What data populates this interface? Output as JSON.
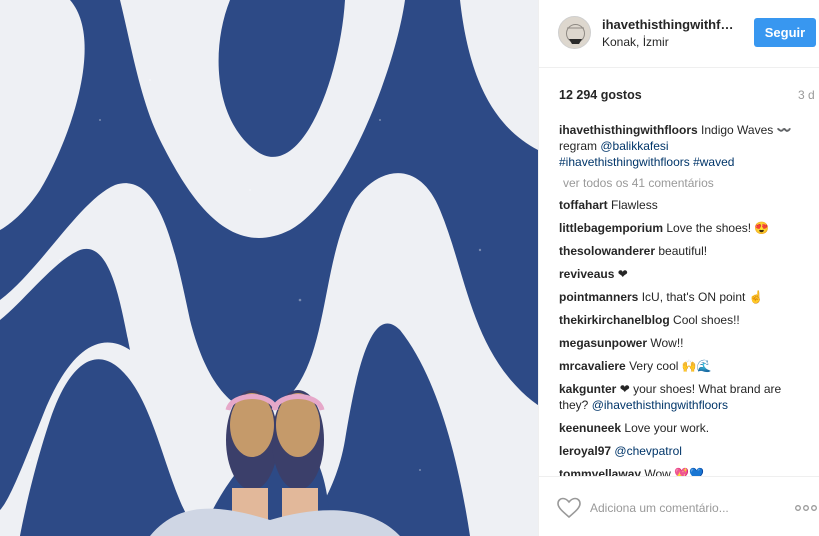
{
  "post": {
    "username": "ihavethisthingwithfloors",
    "location": "Konak, İzmir",
    "follow_label": "Seguir",
    "likes": "12 294 gostos",
    "time": "3 d"
  },
  "caption": {
    "user": "ihavethisthingwithfloors",
    "text": "Indigo Waves 〰️ regram ",
    "mention": "@balikkafesi",
    "tags": "#ihavethisthingwithfloors #waved"
  },
  "load_more": "ver todos os 41 comentários",
  "comments": [
    {
      "user": "toffahart",
      "text": "Flawless",
      "mention": ""
    },
    {
      "user": "littlebagemporium",
      "text": "Love the shoes! 😍",
      "mention": ""
    },
    {
      "user": "thesolowanderer",
      "text": "beautiful!",
      "mention": ""
    },
    {
      "user": "reviveaus",
      "text": "❤",
      "mention": ""
    },
    {
      "user": "pointmanners",
      "text": "IcU, that's ON point ☝",
      "mention": ""
    },
    {
      "user": "thekirkirchanelblog",
      "text": "Cool shoes!!",
      "mention": ""
    },
    {
      "user": "megasunpower",
      "text": "Wow!!",
      "mention": ""
    },
    {
      "user": "mrcavaliere",
      "text": "Very cool 🙌🌊",
      "mention": ""
    },
    {
      "user": "kakgunter",
      "text": "❤ your shoes! What brand are they? ",
      "mention": "@ihavethisthingwithfloors"
    },
    {
      "user": "keenuneek",
      "text": "Love your work.",
      "mention": ""
    },
    {
      "user": "leroyal97",
      "text": "",
      "mention": "@chevpatrol"
    },
    {
      "user": "tommyellaway",
      "text": "Wow 💖💙",
      "mention": ""
    }
  ],
  "footer": {
    "placeholder": "Adiciona um comentário...",
    "more_label": "..."
  },
  "icons": {
    "heart": "heart-icon",
    "more": "more-options-icon",
    "avatar": "avatar"
  },
  "colors": {
    "follow": "#3897f0",
    "wave_blue": "#2d4a86",
    "wave_white": "#eef0f4"
  }
}
